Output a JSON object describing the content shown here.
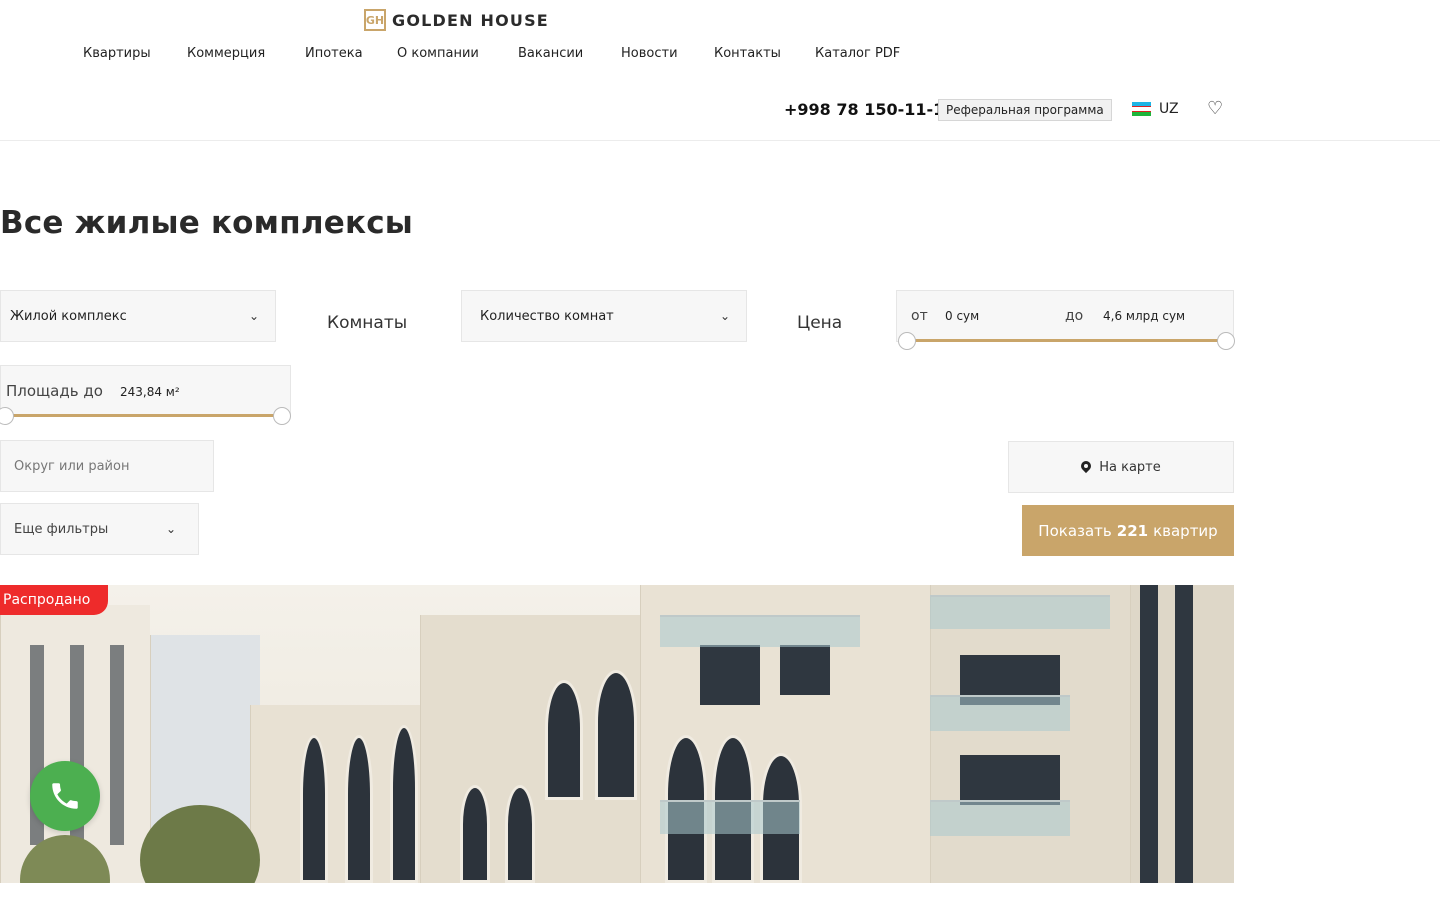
{
  "brand": {
    "logo_mark": "GH",
    "name": "GOLDEN HOUSE"
  },
  "nav": [
    {
      "label": "Квартиры"
    },
    {
      "label": "Коммерция"
    },
    {
      "label": "Ипотека"
    },
    {
      "label": "О компании"
    },
    {
      "label": "Вакансии"
    },
    {
      "label": "Новости"
    },
    {
      "label": "Контакты"
    },
    {
      "label": "Каталог PDF"
    }
  ],
  "header": {
    "phone": "+998 78 150-11-11",
    "referral_label": "Реферальная программа",
    "language": "UZ",
    "favorites_icon": "heart-icon"
  },
  "page": {
    "title": "Все жилые комплексы"
  },
  "filters": {
    "complex_select": "Жилой комплекс",
    "rooms_caption": "Комнаты",
    "rooms_select": "Количество комнат",
    "price_caption": "Цена",
    "price_from_label": "от",
    "price_from_value": "0 сум",
    "price_to_label": "до",
    "price_to_value": "4,6 млрд сум",
    "price_range": {
      "min_fraction": 0.0,
      "max_fraction": 1.0
    },
    "area_label": "Площадь до",
    "area_value": "243,84 м²",
    "area_range": {
      "max_fraction": 1.0
    },
    "district_placeholder": "Округ или район",
    "more_filters": "Еще фильтры",
    "map_button": "На карте",
    "show_button_prefix": "Показать",
    "show_button_count": "221",
    "show_button_suffix": "квартир"
  },
  "listing": {
    "badge": "Распродано"
  },
  "colors": {
    "accent_gold": "#c9a56a",
    "sold_badge": "#ee2b2b",
    "call_button": "#4caf50"
  },
  "icons": {
    "chevron": "chevron-down-icon",
    "map": "map-pin-icon",
    "call": "phone-icon"
  }
}
